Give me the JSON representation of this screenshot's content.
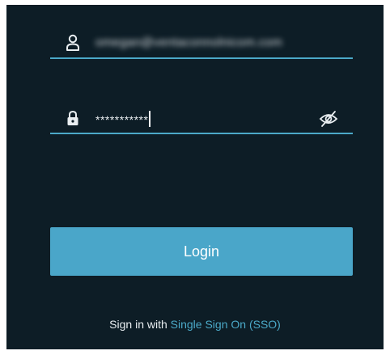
{
  "form": {
    "username": {
      "icon": "user-icon",
      "value": "omegan@ventaconnolnicom.com"
    },
    "password": {
      "icon": "lock-icon",
      "value": "***********",
      "toggle_icon": "eye-off-icon"
    },
    "login_label": "Login",
    "sso_prefix": "Sign in with",
    "sso_link": "Single Sign On (SSO)"
  },
  "colors": {
    "background": "#0d1d26",
    "accent": "#4ba9c8",
    "button": "#4aa6c9",
    "text": "#e9eef1"
  }
}
